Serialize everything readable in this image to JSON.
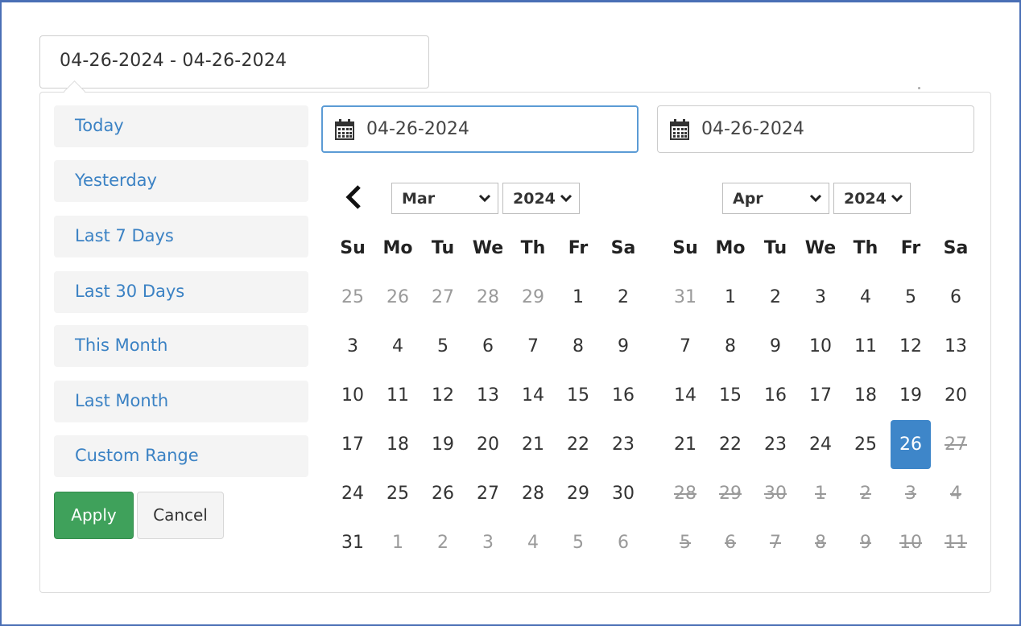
{
  "main_input": {
    "value": "04-26-2024 - 04-26-2024"
  },
  "ranges": [
    {
      "label": "Today",
      "active": true
    },
    {
      "label": "Yesterday",
      "active": false
    },
    {
      "label": "Last 7 Days",
      "active": false
    },
    {
      "label": "Last 30 Days",
      "active": false
    },
    {
      "label": "This Month",
      "active": false
    },
    {
      "label": "Last Month",
      "active": false
    },
    {
      "label": "Custom Range",
      "active": true
    }
  ],
  "buttons": {
    "apply": "Apply",
    "cancel": "Cancel"
  },
  "start_input": {
    "value": "04-26-2024",
    "icon": "calendar-icon"
  },
  "end_input": {
    "value": "04-26-2024",
    "icon": "calendar-icon"
  },
  "weekdays": [
    "Su",
    "Mo",
    "Tu",
    "We",
    "Th",
    "Fr",
    "Sa"
  ],
  "left_calendar": {
    "month": "Mar",
    "year": "2024",
    "weeks": [
      [
        [
          "25",
          "off"
        ],
        [
          "26",
          "off"
        ],
        [
          "27",
          "off"
        ],
        [
          "28",
          "off"
        ],
        [
          "29",
          "off"
        ],
        [
          "1",
          ""
        ],
        [
          "2",
          ""
        ]
      ],
      [
        [
          "3",
          ""
        ],
        [
          "4",
          ""
        ],
        [
          "5",
          ""
        ],
        [
          "6",
          ""
        ],
        [
          "7",
          ""
        ],
        [
          "8",
          ""
        ],
        [
          "9",
          ""
        ]
      ],
      [
        [
          "10",
          ""
        ],
        [
          "11",
          ""
        ],
        [
          "12",
          ""
        ],
        [
          "13",
          ""
        ],
        [
          "14",
          ""
        ],
        [
          "15",
          ""
        ],
        [
          "16",
          ""
        ]
      ],
      [
        [
          "17",
          ""
        ],
        [
          "18",
          ""
        ],
        [
          "19",
          ""
        ],
        [
          "20",
          ""
        ],
        [
          "21",
          ""
        ],
        [
          "22",
          ""
        ],
        [
          "23",
          ""
        ]
      ],
      [
        [
          "24",
          ""
        ],
        [
          "25",
          ""
        ],
        [
          "26",
          ""
        ],
        [
          "27",
          ""
        ],
        [
          "28",
          ""
        ],
        [
          "29",
          ""
        ],
        [
          "30",
          ""
        ]
      ],
      [
        [
          "31",
          ""
        ],
        [
          "1",
          "off"
        ],
        [
          "2",
          "off"
        ],
        [
          "3",
          "off"
        ],
        [
          "4",
          "off"
        ],
        [
          "5",
          "off"
        ],
        [
          "6",
          "off"
        ]
      ]
    ]
  },
  "right_calendar": {
    "month": "Apr",
    "year": "2024",
    "weeks": [
      [
        [
          "31",
          "off"
        ],
        [
          "1",
          ""
        ],
        [
          "2",
          ""
        ],
        [
          "3",
          ""
        ],
        [
          "4",
          ""
        ],
        [
          "5",
          ""
        ],
        [
          "6",
          ""
        ]
      ],
      [
        [
          "7",
          ""
        ],
        [
          "8",
          ""
        ],
        [
          "9",
          ""
        ],
        [
          "10",
          ""
        ],
        [
          "11",
          ""
        ],
        [
          "12",
          ""
        ],
        [
          "13",
          ""
        ]
      ],
      [
        [
          "14",
          ""
        ],
        [
          "15",
          ""
        ],
        [
          "16",
          ""
        ],
        [
          "17",
          ""
        ],
        [
          "18",
          ""
        ],
        [
          "19",
          ""
        ],
        [
          "20",
          ""
        ]
      ],
      [
        [
          "21",
          ""
        ],
        [
          "22",
          ""
        ],
        [
          "23",
          ""
        ],
        [
          "24",
          ""
        ],
        [
          "25",
          ""
        ],
        [
          "26",
          "selected"
        ],
        [
          "27",
          "disabled"
        ]
      ],
      [
        [
          "28",
          "disabled"
        ],
        [
          "29",
          "disabled"
        ],
        [
          "30",
          "disabled"
        ],
        [
          "1",
          "disabled"
        ],
        [
          "2",
          "disabled"
        ],
        [
          "3",
          "disabled"
        ],
        [
          "4",
          "disabled"
        ]
      ],
      [
        [
          "5",
          "disabled"
        ],
        [
          "6",
          "disabled"
        ],
        [
          "7",
          "disabled"
        ],
        [
          "8",
          "disabled"
        ],
        [
          "9",
          "disabled"
        ],
        [
          "10",
          "disabled"
        ],
        [
          "11",
          "disabled"
        ]
      ]
    ]
  },
  "colors": {
    "accent": "#3e86c9",
    "apply": "#3fa15b",
    "range_text": "#3b82c4"
  }
}
